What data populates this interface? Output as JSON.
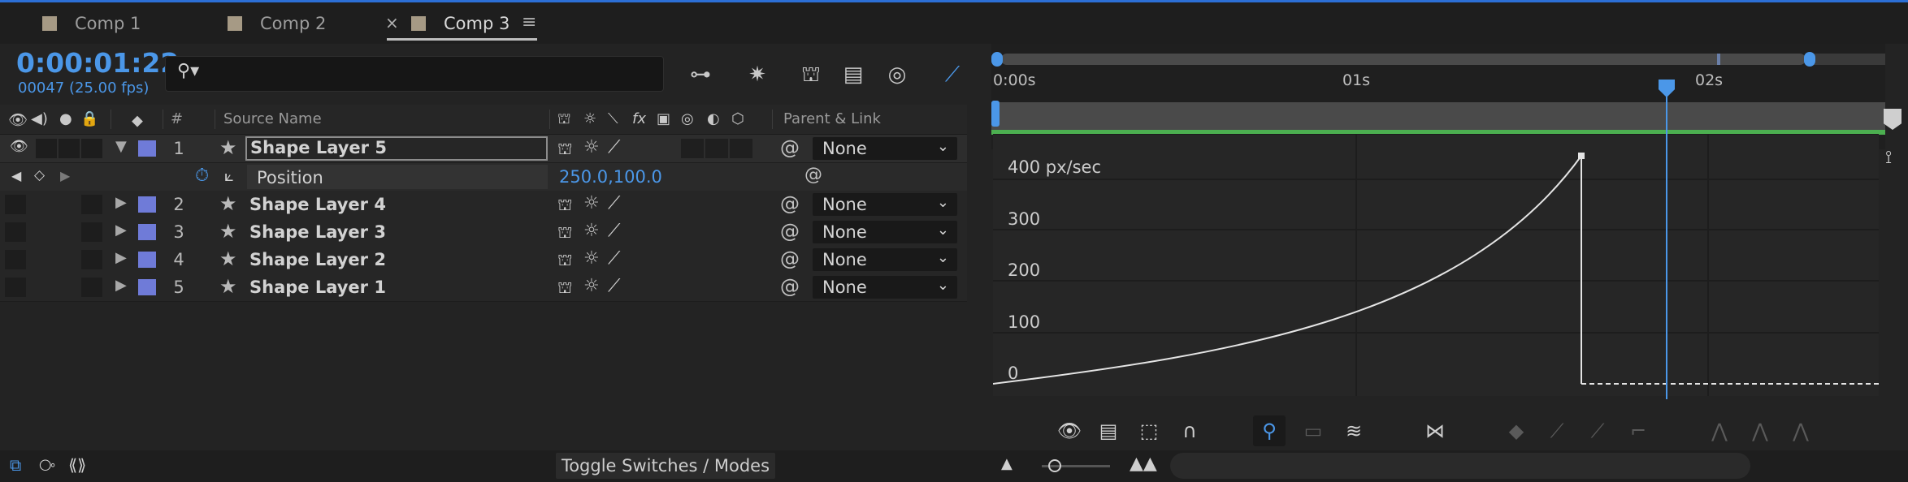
{
  "tabs": [
    {
      "label": "Comp 1",
      "color": "#a69a85",
      "active": false
    },
    {
      "label": "Comp 2",
      "color": "#a69a85",
      "active": false
    },
    {
      "label": "Comp 3",
      "color": "#a69a85",
      "active": true
    }
  ],
  "tab_close": "×",
  "tab_menu": "≡",
  "timecode": "0:00:01:22",
  "frame_info": "00047 (25.00 fps)",
  "search": {
    "placeholder": "",
    "icon": "search-icon"
  },
  "header": {
    "source_name": "Source Name",
    "number": "#",
    "parent_link": "Parent & Link",
    "fx": "fx"
  },
  "layers": [
    {
      "num": "1",
      "name": "Shape Layer 5",
      "parent": "None",
      "expanded": true,
      "selected": true,
      "editing": true
    },
    {
      "num": "2",
      "name": "Shape Layer 4",
      "parent": "None",
      "expanded": false
    },
    {
      "num": "3",
      "name": "Shape Layer 3",
      "parent": "None",
      "expanded": false
    },
    {
      "num": "4",
      "name": "Shape Layer 2",
      "parent": "None",
      "expanded": false
    },
    {
      "num": "5",
      "name": "Shape Layer 1",
      "parent": "None",
      "expanded": false
    }
  ],
  "property": {
    "name": "Position",
    "value": "250.0,100.0"
  },
  "timeline": {
    "labels": [
      "0:00s",
      "01s",
      "02s"
    ],
    "playhead_color": "#4b97e8",
    "work_area_color": "#4caf50"
  },
  "graph": {
    "y_labels": [
      "400 px/sec",
      "300",
      "200",
      "100",
      "0"
    ]
  },
  "bottom": {
    "toggle_label": "Toggle Switches / Modes"
  },
  "colors": {
    "accent": "#4b97e8",
    "layer_label": "#6f7bd8",
    "comp_swatch": "#a69a85"
  }
}
